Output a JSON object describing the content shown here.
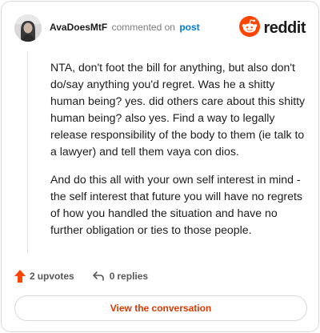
{
  "header": {
    "username": "AvaDoesMtF",
    "action_text": "commented on",
    "post_link": "post",
    "brand": "reddit"
  },
  "comment": {
    "paragraphs": [
      "NTA, don't foot the bill for anything, but also don't do/say anything you'd regret. Was he a shitty human being? yes. did others care about this shitty human being? also yes. Find a way to legally release responsibility of the body to them (ie talk to a lawyer) and tell them vaya con dios.",
      "And do this all with your own self interest in mind - the self interest that future you will have no regrets of how you handled the situation and have no further obligation or ties to those people."
    ]
  },
  "actions": {
    "upvotes_count": "2",
    "upvotes_label": "upvotes",
    "replies_count": "0",
    "replies_label": "replies"
  },
  "footer": {
    "button_label": "View the conversation"
  },
  "colors": {
    "brand_orange": "#ff4500",
    "link_blue": "#0079d3",
    "button_text": "#d93a00"
  },
  "icons": [
    "avatar",
    "reddit-logo-icon",
    "upvote-arrow-icon",
    "reply-arrow-icon"
  ]
}
